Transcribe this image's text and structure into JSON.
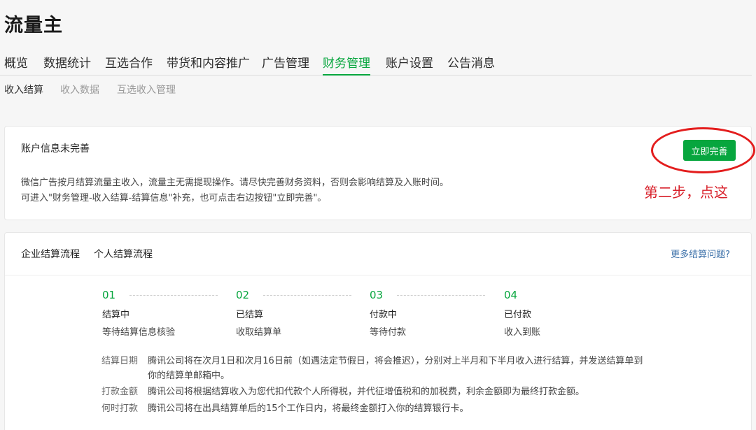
{
  "app_title": "流量主",
  "main_nav": [
    "概览",
    "数据统计",
    "互选合作",
    "带货和内容推广",
    "广告管理",
    "财务管理",
    "账户设置",
    "公告消息"
  ],
  "main_nav_active": "财务管理",
  "sub_nav": [
    "收入结算",
    "收入数据",
    "互选收入管理"
  ],
  "sub_nav_active": "收入结算",
  "alert": {
    "title": "账户信息未完善",
    "line1": "微信广告按月结算流量主收入，流量主无需提现操作。请尽快完善财务资料，否则会影响结算及入账时间。",
    "line2": "可进入\"财务管理-收入结算-结算信息\"补充，也可点击右边按钮\"立即完善\"。",
    "button": "立即完善"
  },
  "annotation": {
    "text": "第二步，点这",
    "color": "#d8202a"
  },
  "flow": {
    "tabs": [
      "企业结算流程",
      "个人结算流程"
    ],
    "more_link": "更多结算问题?",
    "steps": [
      {
        "num": "01",
        "title": "结算中",
        "desc": "等待结算信息核验"
      },
      {
        "num": "02",
        "title": "已结算",
        "desc": "收取结算单"
      },
      {
        "num": "03",
        "title": "付款中",
        "desc": "等待付款"
      },
      {
        "num": "04",
        "title": "已付款",
        "desc": "收入到账"
      }
    ],
    "info": [
      {
        "label": "结算日期",
        "text": "腾讯公司将在次月1日和次月16日前（如遇法定节假日，将会推迟），分别对上半月和下半月收入进行结算，并发送结算单到",
        "cont": "你的结算单邮箱中。"
      },
      {
        "label": "打款金额",
        "text": "腾讯公司将根据结算收入为您代扣代款个人所得税，并代征增值税和的加税费，利余金额即为最终打款金额。"
      },
      {
        "label": "何时打款",
        "text": "腾讯公司将在出具结算单后的15个工作日内，将最终金额打入你的结算银行卡。"
      }
    ]
  },
  "colors": {
    "accent": "#07a63e",
    "link": "#3a6fa8",
    "annotation_circle": "#e31d1d"
  }
}
